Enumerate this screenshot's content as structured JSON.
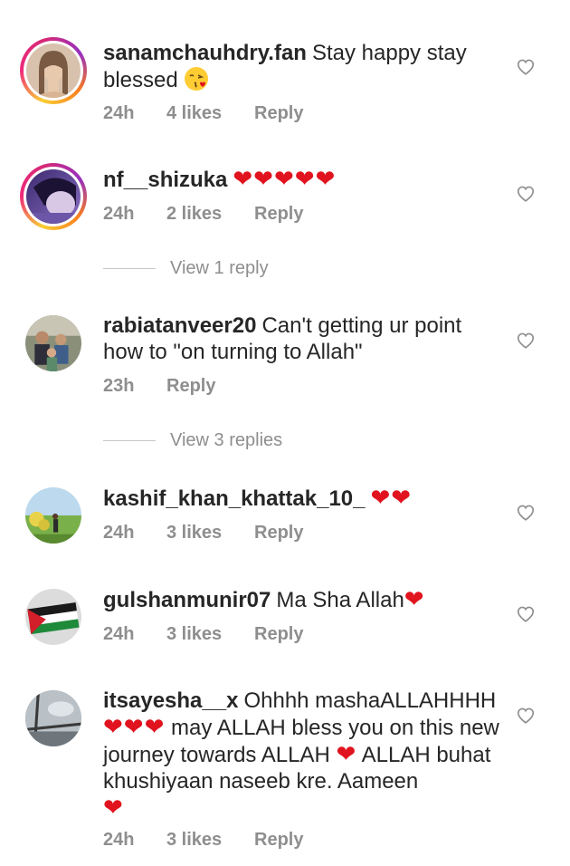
{
  "comments": [
    {
      "username": "sanamchauhdry.fan",
      "text": "Stay happy stay blessed",
      "emoji": "kissing-face-with-heart",
      "time": "24h",
      "likes": "4 likes",
      "reply": "Reply",
      "avatar": "woman-portrait",
      "story_ring": true
    },
    {
      "username": "nf__shizuka",
      "text": "",
      "hearts": "❤❤❤❤❤",
      "time": "24h",
      "likes": "2 likes",
      "reply": "Reply",
      "avatar": "purple-selfie",
      "story_ring": true,
      "view_replies": "View 1 reply"
    },
    {
      "username": "rabiatanveer20",
      "text": "Can't getting ur point how to \"on turning to Allah\"",
      "time": "23h",
      "likes": "",
      "reply": "Reply",
      "avatar": "group-photo",
      "story_ring": false,
      "view_replies": "View 3 replies"
    },
    {
      "username": "kashif_khan_khattak_10_",
      "text": "",
      "hearts": "❤❤",
      "time": "24h",
      "likes": "3 likes",
      "reply": "Reply",
      "avatar": "landscape-photo",
      "story_ring": false
    },
    {
      "username": "gulshanmunir07",
      "text": "Ma Sha Allah",
      "hearts": "❤",
      "time": "24h",
      "likes": "3 likes",
      "reply": "Reply",
      "avatar": "palestine-flag",
      "story_ring": false
    },
    {
      "username": "itsayesha__x",
      "text_part1": "Ohhhh mashaALLAHHHH",
      "hearts_a": "❤❤❤",
      "text_part2": "may ALLAH bless you on this new journey towards ALLAH",
      "hearts_b": "❤",
      "text_part3": "ALLAH buhat khushiyaan naseeb kre. Aameen",
      "hearts_c": "❤",
      "time": "24h",
      "likes": "3 likes",
      "reply": "Reply",
      "avatar": "window-sky",
      "story_ring": false
    }
  ],
  "colors": {
    "text": "#262626",
    "meta": "#8e8e8e",
    "heart": "#e0131e"
  },
  "icons": {
    "like": "heart-outline-icon"
  }
}
